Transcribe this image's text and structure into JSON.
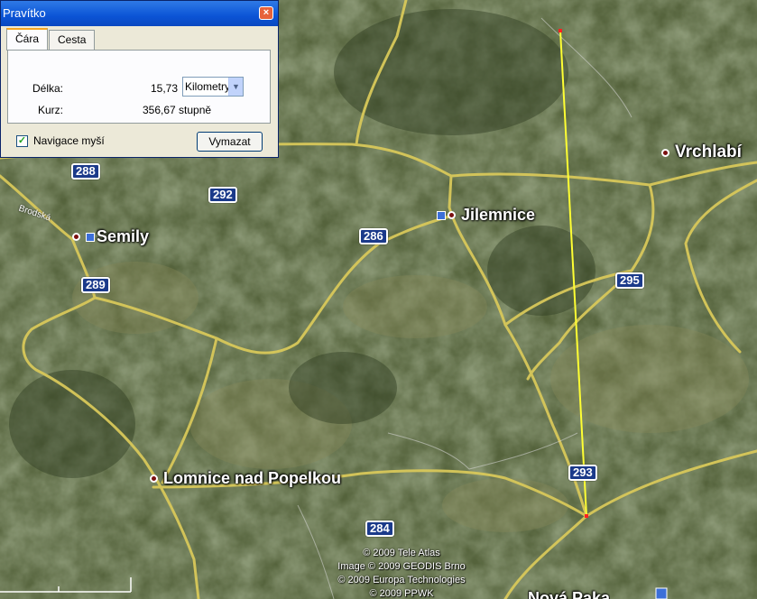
{
  "dialog": {
    "title": "Pravítko",
    "close_glyph": "×",
    "tabs": [
      {
        "label": "Čára"
      },
      {
        "label": "Cesta"
      }
    ],
    "length_label": "Délka:",
    "length_value": "15,73",
    "unit_selected": "Kilometry",
    "heading_label": "Kurz:",
    "heading_value": "356,67 stupně",
    "mouse_nav_label": "Navigace myší",
    "mouse_nav_checked": true,
    "clear_button": "Vymazat"
  },
  "map": {
    "towns": [
      "Vrchlabí",
      "Jilemnice",
      "Semily",
      "Lomnice nad Popelkou",
      "Nová Paka"
    ],
    "road_shields": [
      "288",
      "292",
      "286",
      "289",
      "295",
      "293",
      "284"
    ],
    "street_label": "Brodská",
    "credits": [
      "© 2009 Tele Atlas",
      "Image © 2009 GEODIS Brno",
      "© 2009 Europa Technologies",
      "© 2009 PPWK"
    ],
    "ruler_color": "#ffff33",
    "road_color": "#d8c85a"
  }
}
